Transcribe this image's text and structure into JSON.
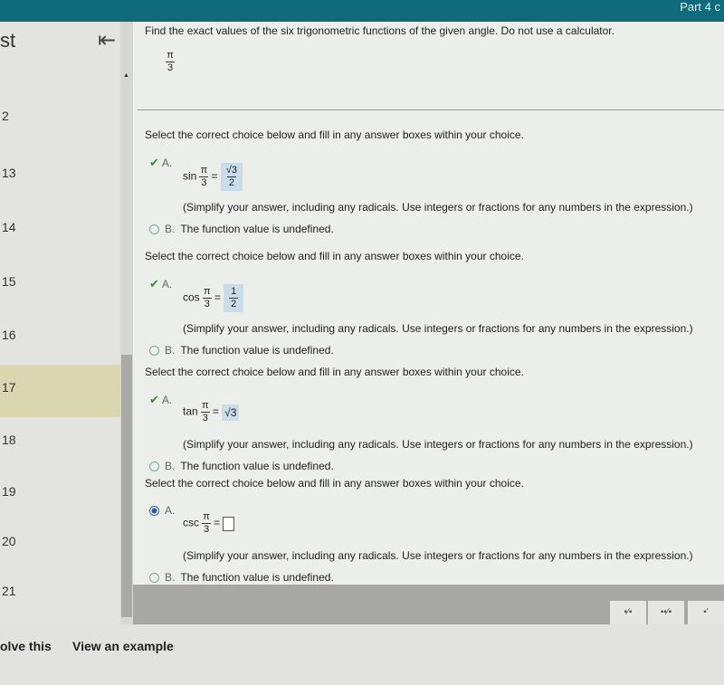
{
  "header": {
    "part_label": "Part 4 c"
  },
  "sidebar": {
    "title_fragment": "st",
    "items": [
      "2",
      "13",
      "14",
      "15",
      "16",
      "17",
      "18",
      "19",
      "20",
      "21"
    ],
    "highlighted": "17"
  },
  "question": {
    "prompt": "Find the exact values of the six trigonometric functions of the given angle. Do not use a calculator.",
    "angle": {
      "num": "π",
      "den": "3"
    }
  },
  "parts": [
    {
      "instruction": "Select the correct choice below and fill in any answer boxes within your choice.",
      "func": "sin",
      "answer": {
        "num": "√3",
        "den": "2"
      },
      "a_label": "A.",
      "b_label": "B.",
      "hint": "(Simplify your answer, including any radicals. Use integers or fractions for any numbers in the expression.)",
      "b_text": "The function value is undefined.",
      "status": "correct"
    },
    {
      "instruction": "Select the correct choice below and fill in any answer boxes within your choice.",
      "func": "cos",
      "answer": {
        "num": "1",
        "den": "2"
      },
      "a_label": "A.",
      "b_label": "B.",
      "hint": "(Simplify your answer, including any radicals. Use integers or fractions for any numbers in the expression.)",
      "b_text": "The function value is undefined.",
      "status": "correct"
    },
    {
      "instruction": "Select the correct choice below and fill in any answer boxes within your choice.",
      "func": "tan",
      "answer": {
        "value": "√3"
      },
      "a_label": "A.",
      "b_label": "B.",
      "hint": "(Simplify your answer, including any radicals. Use integers or fractions for any numbers in the expression.)",
      "b_text": "The function value is undefined.",
      "status": "correct"
    },
    {
      "instruction": "Select the correct choice below and fill in any answer boxes within your choice.",
      "func": "csc",
      "answer": {
        "value": ""
      },
      "a_label": "A.",
      "b_label": "B.",
      "hint": "(Simplify your answer, including any radicals. Use integers or fractions for any numbers in the expression.)",
      "b_text": "The function value is undefined.",
      "status": "selected-A"
    }
  ],
  "toolbar": {
    "buttons": [
      "fraction",
      "mixed-number",
      "exponent"
    ]
  },
  "footer": {
    "solve_label": "olve this",
    "example_label": "View an example"
  },
  "colors": {
    "topbar": "#0f6a7c",
    "highlight": "#d9d6b0",
    "answer_box": "#c9dcea",
    "check": "#3a8a3a",
    "radio_selected": "#2c5fa8"
  }
}
